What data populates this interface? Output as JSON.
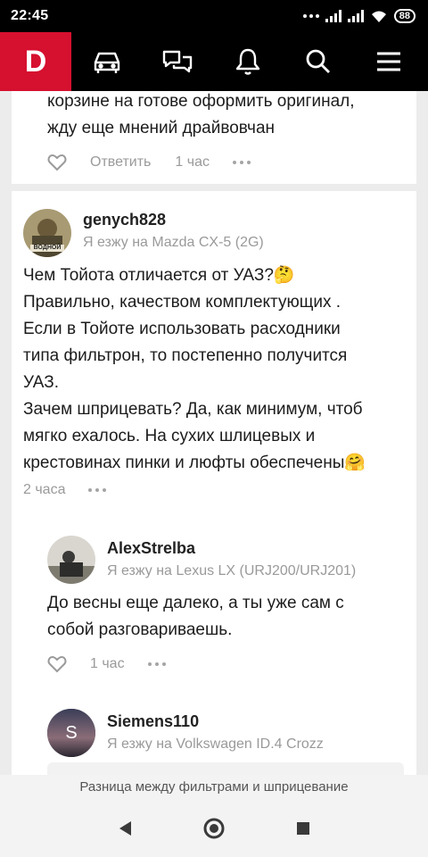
{
  "status_bar": {
    "time": "22:45",
    "battery": "88"
  },
  "nav": {
    "logo": "D"
  },
  "comment_prev": {
    "text_line1": "корзине на готове оформить оригинал,",
    "text_line2": "жду еще мнений драйвовчан",
    "reply_label": "Ответить",
    "time": "1 час"
  },
  "comment_main": {
    "author": "genych828",
    "avatar_caption": "ВОДНОЙ",
    "car": "Я езжу на Mazda CX-5 (2G)",
    "lines": [
      "Чем Тойота отличается от УАЗ?🤔",
      "Правильно, качеством комплектующих .",
      "Если в Тойоте использовать расходники",
      "типа фильтрон, то постепенно получится",
      "УАЗ.",
      "Зачем шприцевать? Да, как минимум, чтоб",
      "мягко ехалось. На сухих шлицевых и",
      "крестовинах пинки и люфты обеспечены🤗"
    ],
    "time": "2 часа"
  },
  "reply_1": {
    "author": "AlexStrelba",
    "car": "Я езжу на Lexus LX (URJ200/URJ201)",
    "text_line1": "До весны еще далеко, а ты уже сам с",
    "text_line2": "собой разговариваешь.",
    "time": "1 час"
  },
  "reply_2": {
    "author": "Siemens110",
    "avatar_letter": "S",
    "car": "Я езжу на Volkswagen ID.4 Crozz"
  },
  "bottom_banner": "Разница между фильтрами и шприцевание",
  "colors": {
    "brand": "#d6102f",
    "muted": "#9a9a9a",
    "background": "#ececec"
  }
}
